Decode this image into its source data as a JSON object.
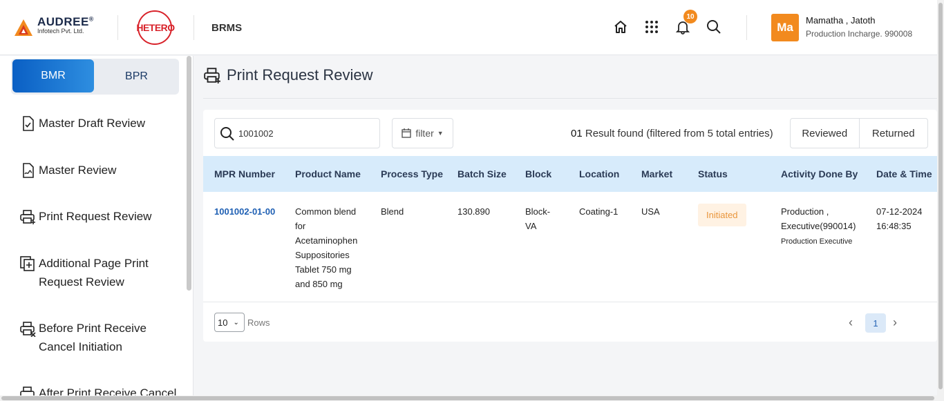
{
  "header": {
    "company_name": "AUDREE",
    "company_reg": "®",
    "company_sub": "Infotech Pvt. Ltd.",
    "client_logo_text": "HETERO",
    "app_name": "BRMS",
    "notification_count": "10",
    "user": {
      "initials": "Ma",
      "name": "Mamatha , Jatoth",
      "role": "Production Incharge. 990008"
    },
    "icons": [
      "home-icon",
      "apps-grid-icon",
      "bell-icon",
      "search-icon"
    ]
  },
  "sidebar": {
    "tabs": [
      {
        "label": "BMR",
        "active": true
      },
      {
        "label": "BPR",
        "active": false
      }
    ],
    "items": [
      {
        "label": "Master Draft Review",
        "icon": "document-check-icon"
      },
      {
        "label": "Master Review",
        "icon": "document-signature-icon"
      },
      {
        "label": "Print Request Review",
        "icon": "printer-add-icon"
      },
      {
        "label_line1": "Additional Page Print",
        "label_line2": "Request Review",
        "icon": "page-add-icon"
      },
      {
        "label_line1": "Before Print Receive",
        "label_line2": "Cancel Initiation",
        "icon": "printer-cancel-icon"
      },
      {
        "label": "After Print Receive Cancel",
        "icon": "printer-icon"
      }
    ]
  },
  "main": {
    "title": "Print Request Review",
    "search": {
      "value": "1001002"
    },
    "filter_label": "filter",
    "result": {
      "count": "01",
      "text": "Result found (filtered from 5 total entries)"
    },
    "segments": [
      "Reviewed",
      "Returned"
    ],
    "table": {
      "columns": [
        "MPR Number",
        "Product Name",
        "Process Type",
        "Batch Size",
        "Block",
        "Location",
        "Market",
        "Status",
        "Activity Done By",
        "Date & Time"
      ],
      "rows": [
        {
          "mpr": "1001002-01-00",
          "product": [
            "Common blend",
            "for",
            "Acetaminophen",
            "Suppositories",
            "Tablet 750 mg",
            "and 850 mg"
          ],
          "process": "Blend",
          "batch": "130.890",
          "block": [
            "Block-",
            "VA"
          ],
          "location": "Coating-1",
          "market": "USA",
          "status": "Initiated",
          "activity": [
            "Production ,",
            "Executive(990014)"
          ],
          "activity_role": "Production Executive",
          "date": [
            "07-12-2024",
            "16:48:35"
          ]
        }
      ]
    },
    "pagination": {
      "rows_value": "10",
      "rows_label": "Rows",
      "current_page": "1"
    }
  }
}
